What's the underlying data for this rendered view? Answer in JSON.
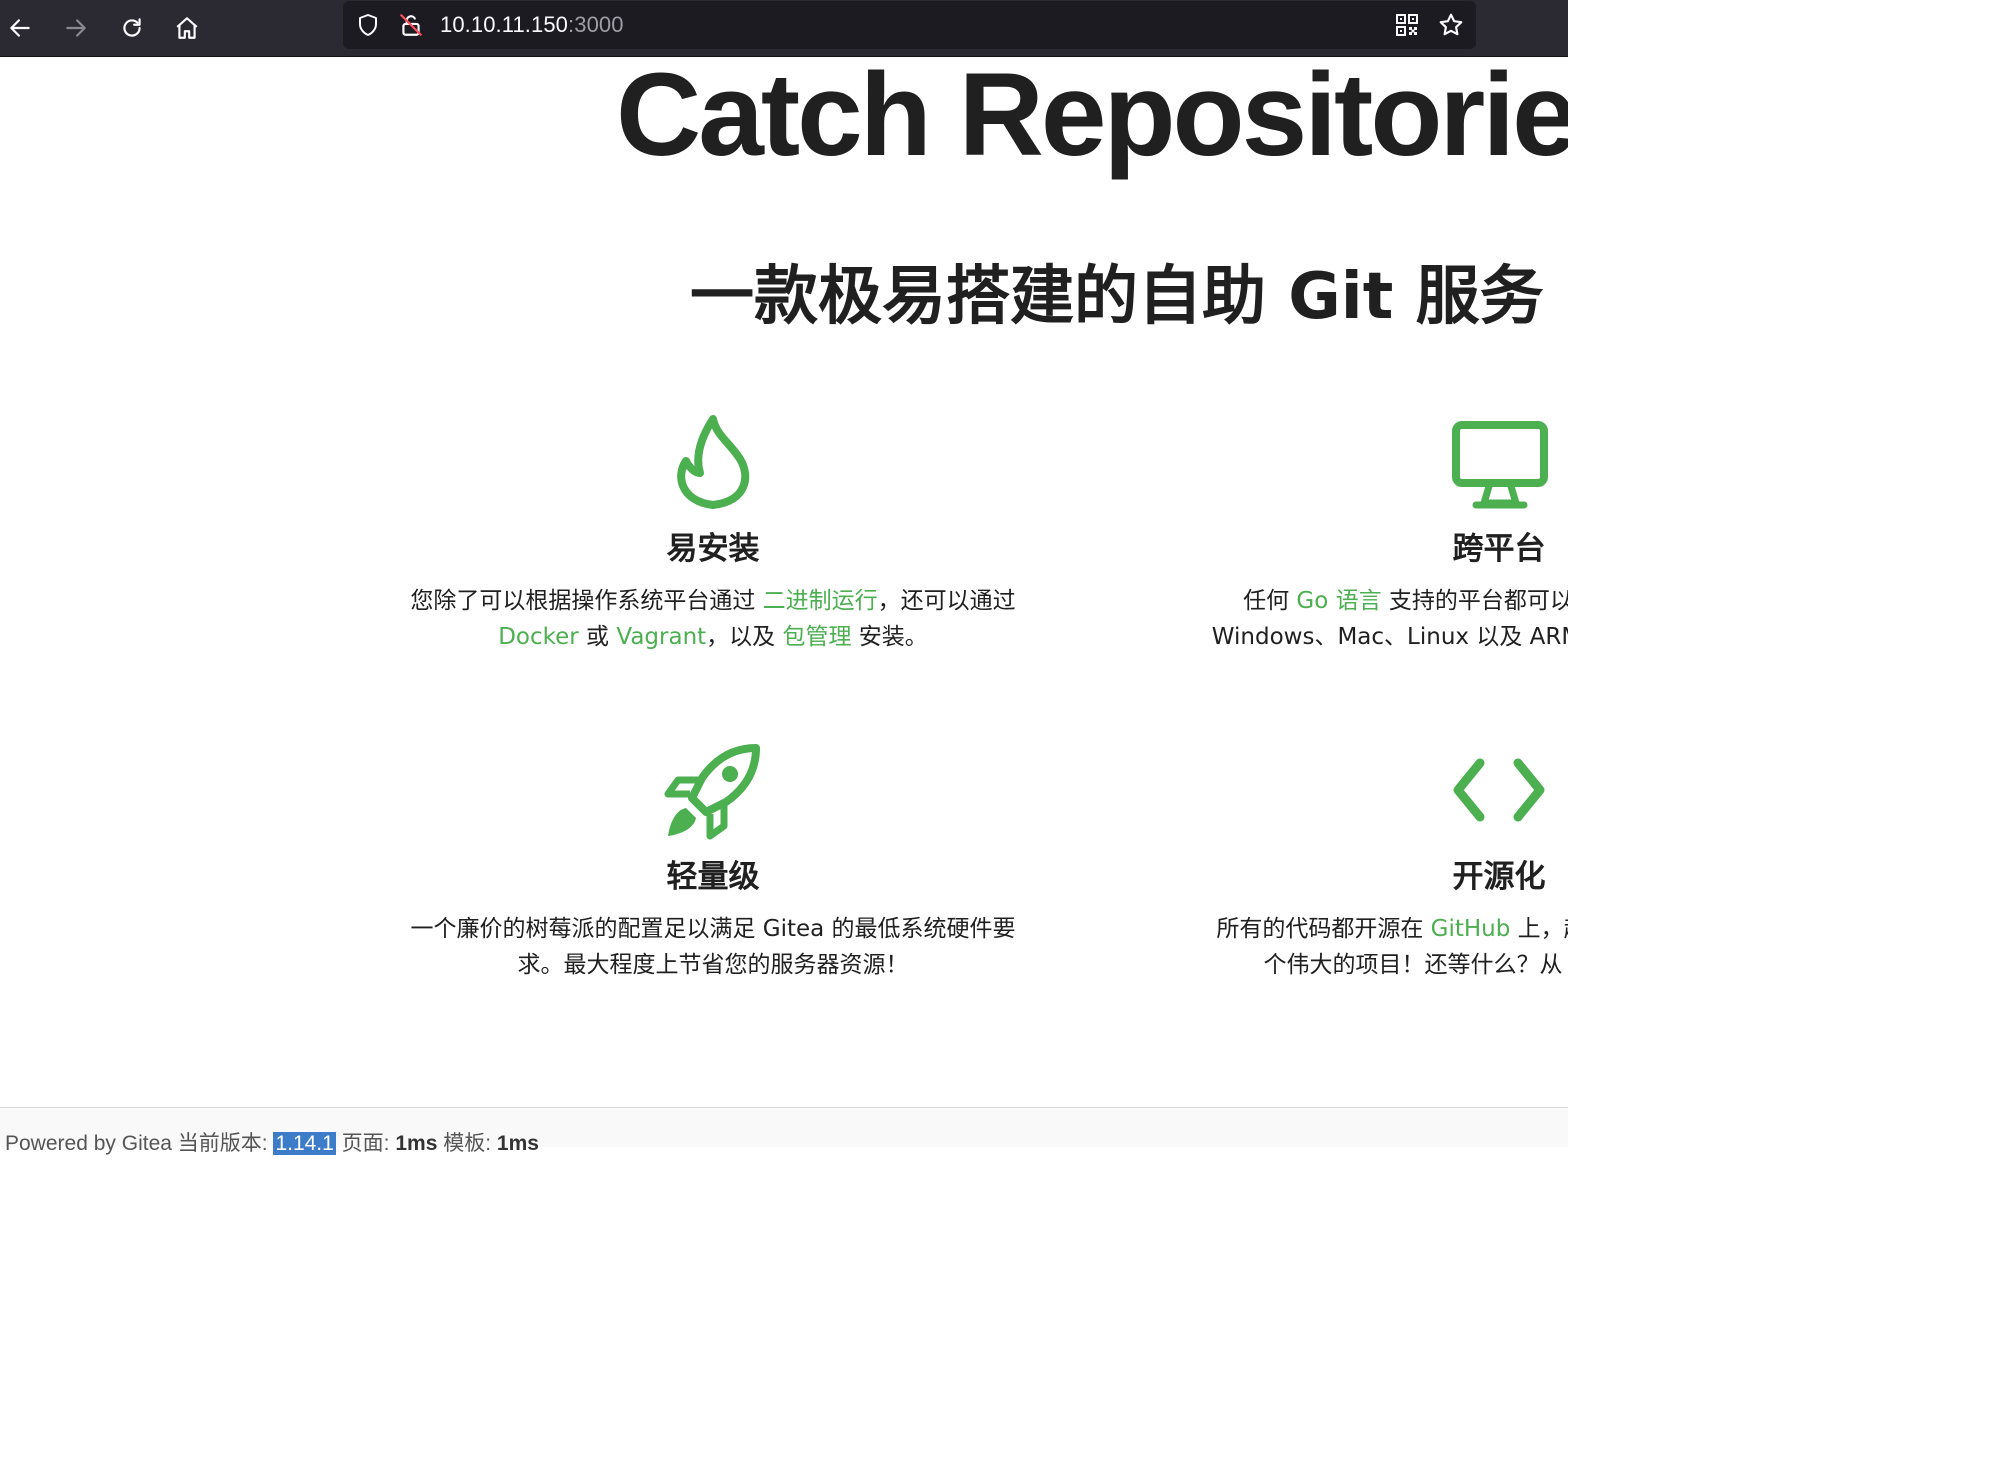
{
  "browser": {
    "url_host": "10.10.11.150",
    "url_port": ":3000",
    "icons": [
      "back-arrow-icon",
      "forward-arrow-icon",
      "reload-icon",
      "home-icon",
      "shield-icon",
      "insecure-lock-icon",
      "qr-code-icon",
      "bookmark-star-icon"
    ]
  },
  "hero": {
    "title": "Catch Repositories",
    "subtitle": "一款极易搭建的自助 Git 服务"
  },
  "features": {
    "install": {
      "title": "易安装",
      "line1_a": "您除了可以根据操作系统平台通过 ",
      "line1_link": "二进制运行",
      "line1_b": "，还可以通过",
      "line2_link1": "Docker",
      "line2_a": " 或 ",
      "line2_link2": "Vagrant",
      "line2_b": "，以及 ",
      "line2_link3": "包管理",
      "line2_c": " 安装。"
    },
    "cross_platform": {
      "title": "跨平台",
      "line1_a": "任何 ",
      "line1_link": "Go 语言",
      "line1_b": " 支持的平台都可以",
      "line2": "Windows、Mac、Linux 以及 ARM。"
    },
    "lightweight": {
      "title": "轻量级",
      "line1": "一个廉价的树莓派的配置足以满足 Gitea 的最低系统硬件要",
      "line2": "求。最大程度上节省您的服务器资源！"
    },
    "open_source": {
      "title": "开源化",
      "line1_a": "所有的代码都开源在 ",
      "line1_link": "GitHub",
      "line1_b": " 上，赶快",
      "line2": "个伟大的项目！还等什么？从"
    }
  },
  "footer": {
    "powered": "Powered by Gitea 当前版本: ",
    "version": "1.14.1",
    "page_label": " 页面: ",
    "page_time": "1ms",
    "tpl_label": " 模板: ",
    "tpl_time": "1ms"
  },
  "colors": {
    "accent": "#4caf50",
    "toolbar_bg": "#2b2a33",
    "urlbar_bg": "#1c1b22"
  }
}
